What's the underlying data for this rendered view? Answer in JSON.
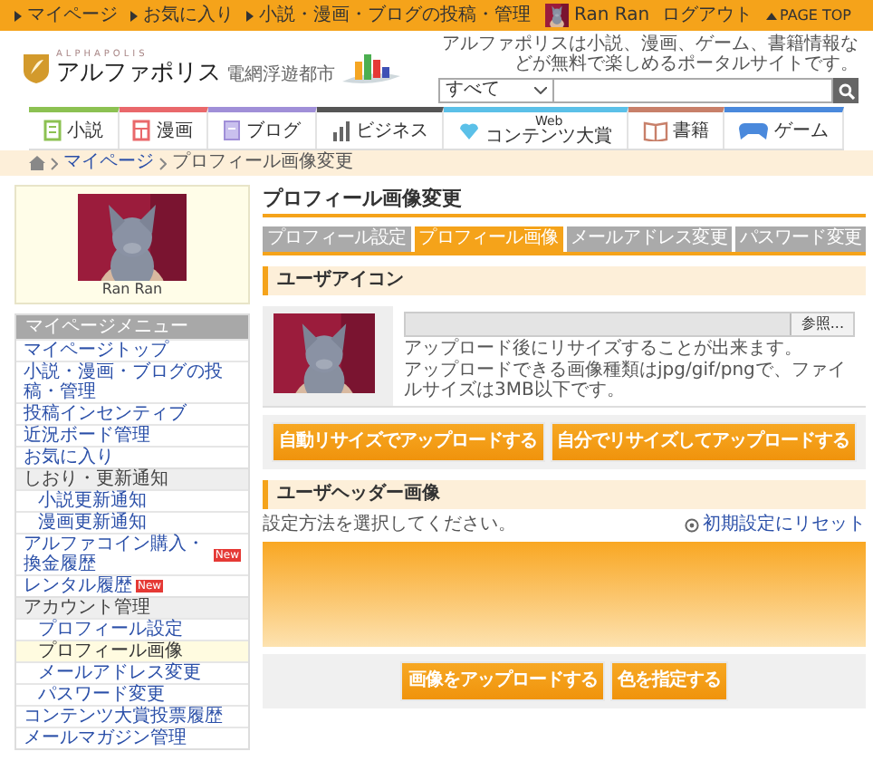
{
  "top_bar": {
    "links": [
      "マイページ",
      "お気に入り",
      "小説・漫画・ブログの投稿・管理"
    ],
    "user_name": "Ran Ran",
    "logout": "ログアウト",
    "page_top": "PAGE TOP"
  },
  "header": {
    "logo_roman": "ALPHAPOLIS",
    "logo": "アルファポリス",
    "logo_subtitle": "電網浮遊都市",
    "tagline": "アルファポリスは小説、漫画、ゲーム、書籍情報などが無料で楽しめるポータルサイトです。",
    "search": {
      "category": "すべて"
    }
  },
  "nav": [
    {
      "label": "小説",
      "kind": "novel",
      "color": "#8cc152"
    },
    {
      "label": "漫画",
      "kind": "manga",
      "color": "#e9686b"
    },
    {
      "label": "ブログ",
      "kind": "blog",
      "color": "#a08fd8"
    },
    {
      "label": "ビジネス",
      "kind": "business",
      "color": "#555555"
    },
    {
      "label": "コンテンツ大賞",
      "prefix": "Web",
      "kind": "award",
      "color": "#5bc0e8"
    },
    {
      "label": "書籍",
      "kind": "books",
      "color": "#c8806a"
    },
    {
      "label": "ゲーム",
      "kind": "game",
      "color": "#4a89dc"
    }
  ],
  "breadcrumb": [
    "マイページ",
    "プロフィール画像変更"
  ],
  "sidebar": {
    "profile_name": "Ran Ran",
    "menu_title": "マイページメニュー",
    "items": [
      {
        "label": "マイページトップ",
        "kind": "link",
        "selected": false
      },
      {
        "label": "小説・漫画・ブログの投稿・管理",
        "kind": "link",
        "selected": false
      },
      {
        "label": "投稿インセンティブ",
        "kind": "link",
        "selected": false
      },
      {
        "label": "近況ボード管理",
        "kind": "link",
        "selected": false
      },
      {
        "label": "お気に入り",
        "kind": "link",
        "selected": false
      },
      {
        "label": "しおり・更新通知",
        "kind": "group",
        "children": [
          {
            "label": "小説更新通知",
            "kind": "link",
            "selected": false
          },
          {
            "label": "漫画更新通知",
            "kind": "link",
            "selected": false
          }
        ]
      },
      {
        "label": "アルファコイン購入・換金履歴",
        "kind": "link",
        "selected": false,
        "badge": "New"
      },
      {
        "label": "レンタル履歴",
        "kind": "link",
        "selected": false,
        "badge": "New"
      },
      {
        "label": "アカウント管理",
        "kind": "group",
        "children": [
          {
            "label": "プロフィール設定",
            "kind": "link",
            "selected": false
          },
          {
            "label": "プロフィール画像",
            "kind": "link",
            "selected": true
          },
          {
            "label": "メールアドレス変更",
            "kind": "link",
            "selected": false
          },
          {
            "label": "パスワード変更",
            "kind": "link",
            "selected": false
          }
        ]
      },
      {
        "label": "コンテンツ大賞投票履歴",
        "kind": "link",
        "selected": false
      },
      {
        "label": "メールマガジン管理",
        "kind": "link",
        "selected": false
      }
    ]
  },
  "main": {
    "title": "プロフィール画像変更",
    "tabs": [
      {
        "label": "プロフィール設定",
        "selected": false
      },
      {
        "label": "プロフィール画像",
        "selected": true
      },
      {
        "label": "メールアドレス変更",
        "selected": false
      },
      {
        "label": "パスワード変更",
        "selected": false
      }
    ],
    "icon_section": {
      "title": "ユーザアイコン",
      "browse": "参照...",
      "notes": [
        "アップロード後にリサイズすることが出来ます。",
        "アップロードできる画像種類はjpg/gif/pngで、ファイルサイズは3MB以下です。"
      ],
      "buttons": [
        "自動リサイズでアップロードする",
        "自分でリサイズしてアップロードする"
      ]
    },
    "header_section": {
      "title": "ユーザヘッダー画像",
      "instruction": "設定方法を選択してください。",
      "reset": "初期設定にリセット",
      "buttons": [
        "画像をアップロードする",
        "色を指定する"
      ]
    }
  }
}
